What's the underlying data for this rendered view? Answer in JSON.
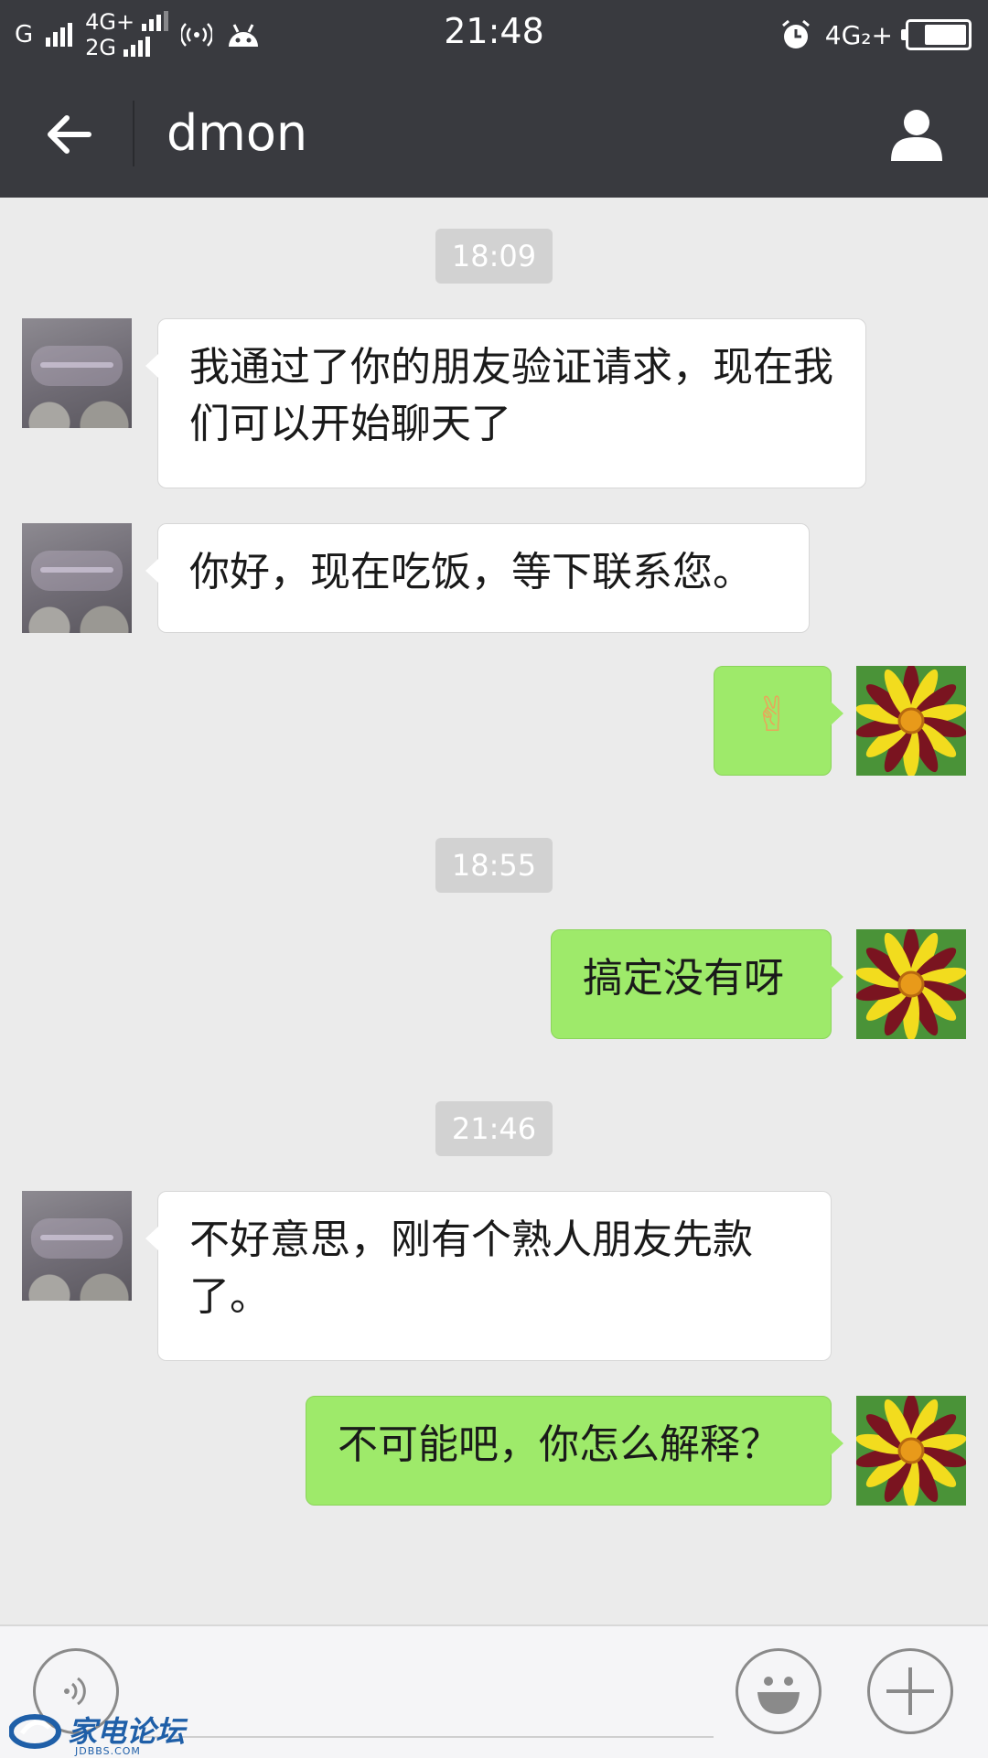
{
  "status_bar": {
    "network_1": "G",
    "network_2": "4G+",
    "network_3": "2G",
    "time": "21:48",
    "right_network": "4G₂+",
    "battery_level": 0.8
  },
  "header": {
    "title": "dmon",
    "back_icon": "arrow-left-icon",
    "profile_icon": "person-icon"
  },
  "messages": [
    {
      "type": "time",
      "text": "18:09"
    },
    {
      "type": "msg",
      "side": "left",
      "text": "我通过了你的朋友验证请求，现在我们可以开始聊天了"
    },
    {
      "type": "msg",
      "side": "left",
      "text": "你好，现在吃饭，等下联系您。"
    },
    {
      "type": "msg",
      "side": "right",
      "text": "✌"
    },
    {
      "type": "time",
      "text": "18:55"
    },
    {
      "type": "msg",
      "side": "right",
      "text": "搞定没有呀"
    },
    {
      "type": "time",
      "text": "21:46"
    },
    {
      "type": "msg",
      "side": "left",
      "text": "不好意思，刚有个熟人朋友先款了。"
    },
    {
      "type": "msg",
      "side": "right",
      "text": "不可能吧，你怎么解释？"
    }
  ],
  "input_bar": {
    "voice_icon": "voice-icon",
    "emoji_icon": "smiley-icon",
    "plus_icon": "plus-icon"
  },
  "watermark": {
    "text": "家电论坛",
    "sub": "JDBBS.COM"
  },
  "colors": {
    "header_bg": "#393a3f",
    "chat_bg": "#ebebeb",
    "incoming_bubble": "#ffffff",
    "outgoing_bubble": "#9eea6a",
    "timestamp_bg": "#d2d2d2"
  }
}
